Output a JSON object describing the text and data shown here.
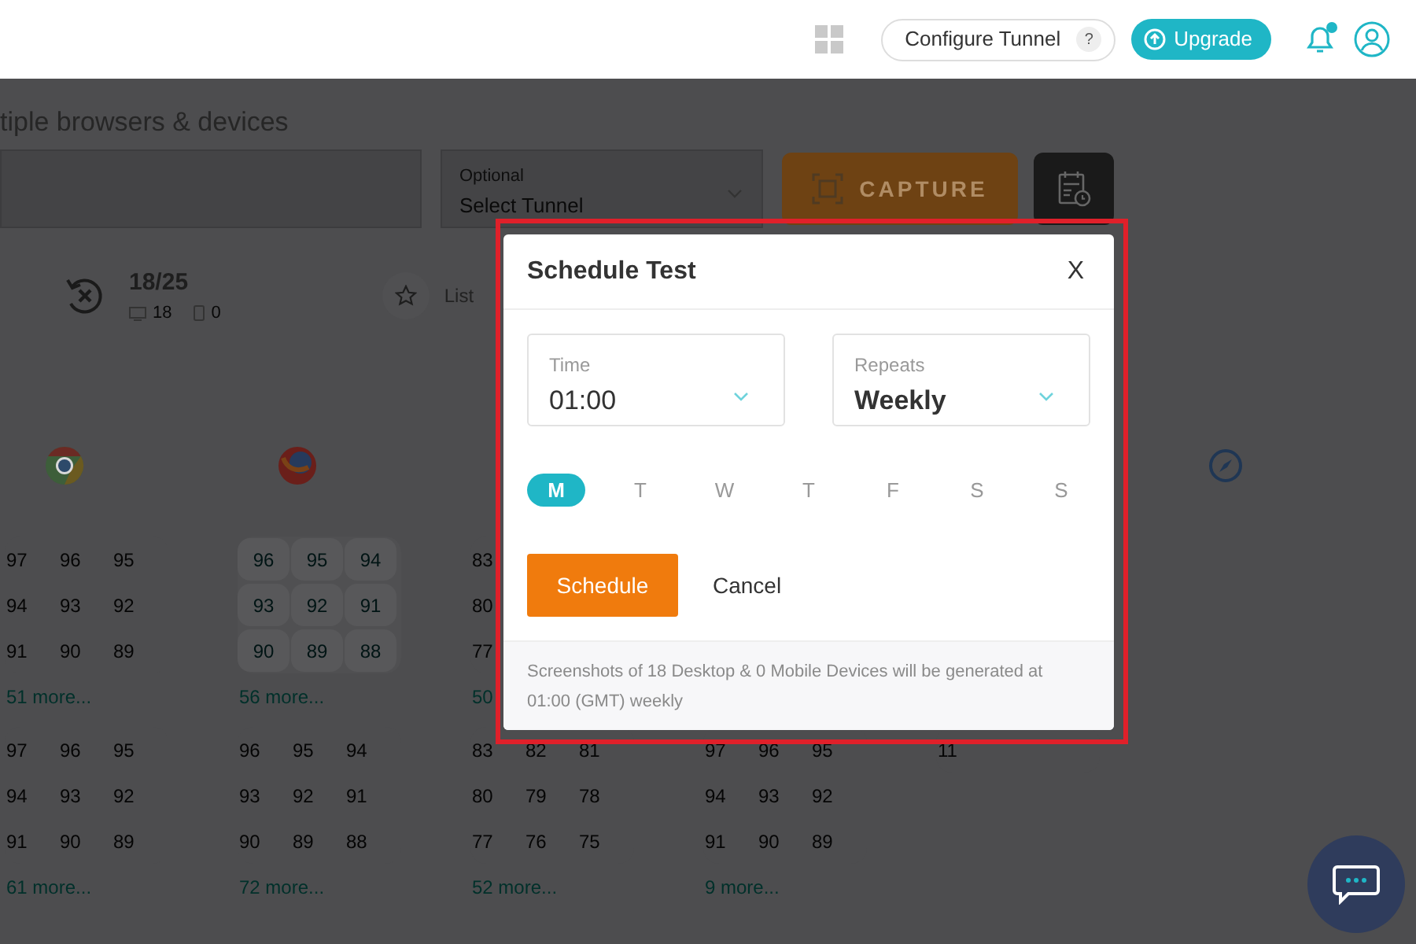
{
  "header": {
    "configure_tunnel": {
      "label": "Configure Tunnel",
      "help": "?"
    },
    "upgrade": "Upgrade",
    "notification_dot": true
  },
  "page": {
    "heading": "tiple browsers & devices",
    "tunnel_select": {
      "label": "Optional",
      "placeholder": "Select Tunnel"
    },
    "capture": "CAPTURE",
    "summary": {
      "count": "18/25",
      "desktop": "18",
      "mobile": "0"
    },
    "list_label": "List"
  },
  "columns": [
    {
      "top_group": {
        "highlighted": false,
        "rows": [
          [
            "97",
            "96",
            "95"
          ],
          [
            "94",
            "93",
            "92"
          ],
          [
            "91",
            "90",
            "89"
          ]
        ],
        "more": "51 more..."
      },
      "bottom_group": {
        "highlighted": false,
        "rows": [
          [
            "97",
            "96",
            "95"
          ],
          [
            "94",
            "93",
            "92"
          ],
          [
            "91",
            "90",
            "89"
          ]
        ],
        "more": "61 more..."
      }
    },
    {
      "top_group": {
        "highlighted": true,
        "rows": [
          [
            "96",
            "95",
            "94"
          ],
          [
            "93",
            "92",
            "91"
          ],
          [
            "90",
            "89",
            "88"
          ]
        ],
        "more": "56 more..."
      },
      "bottom_group": {
        "highlighted": false,
        "rows": [
          [
            "96",
            "95",
            "94"
          ],
          [
            "93",
            "92",
            "91"
          ],
          [
            "90",
            "89",
            "88"
          ]
        ],
        "more": "72 more..."
      }
    },
    {
      "top_group": {
        "highlighted": false,
        "rows": [
          [
            "83"
          ],
          [
            "80"
          ],
          [
            "77"
          ]
        ],
        "more": "50"
      },
      "bottom_group": {
        "highlighted": false,
        "rows": [
          [
            "83",
            "82",
            "81"
          ],
          [
            "80",
            "79",
            "78"
          ],
          [
            "77",
            "76",
            "75"
          ]
        ],
        "more": "52 more..."
      }
    },
    {
      "bottom_group": {
        "highlighted": false,
        "rows": [
          [
            "97",
            "96",
            "95"
          ],
          [
            "94",
            "93",
            "92"
          ],
          [
            "91",
            "90",
            "89"
          ]
        ],
        "more": "9 more..."
      }
    },
    {
      "bottom_group": {
        "highlighted": false,
        "rows": [
          [
            "11"
          ]
        ]
      }
    }
  ],
  "modal": {
    "title": "Schedule Test",
    "close": "X",
    "fields": [
      {
        "label": "Time",
        "value": "01:00"
      },
      {
        "label": "Repeats",
        "value": "Weekly"
      }
    ],
    "days": [
      {
        "label": "M",
        "selected": true
      },
      {
        "label": "T",
        "selected": false
      },
      {
        "label": "W",
        "selected": false
      },
      {
        "label": "T",
        "selected": false
      },
      {
        "label": "F",
        "selected": false
      },
      {
        "label": "S",
        "selected": false
      },
      {
        "label": "S",
        "selected": false
      }
    ],
    "primary": "Schedule",
    "secondary": "Cancel",
    "note": "Screenshots of 18 Desktop & 0 Mobile Devices will be generated at 01:00 (GMT) weekly"
  }
}
